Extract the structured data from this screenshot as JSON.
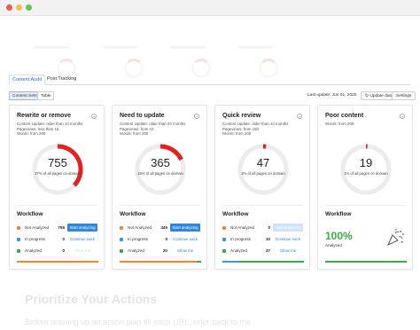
{
  "colors": {
    "accent_blue": "#2f86de",
    "red": "#e32121",
    "orange": "#f1862c",
    "blue": "#3d95e8",
    "green": "#3bab48",
    "ring_track": "#ececec"
  },
  "tabs": [
    {
      "label": "Content Audit",
      "active": true
    },
    {
      "label": "Post Tracking",
      "active": false
    }
  ],
  "toolbar": {
    "view_options": [
      "Content Sets",
      "Table"
    ],
    "active_view": "Content Sets",
    "last_update": "Last update: Jun 01, 2020",
    "update_button": "Update data",
    "settings_button": "Settings"
  },
  "cards": [
    {
      "title": "Rewrite or remove",
      "subtitle": [
        "Content Update: older than 24 months",
        "Pageviews: less than 15",
        "Words: from 200"
      ],
      "count": "755",
      "percent_text": "37% of all pages on domain",
      "percent": 37,
      "ring_color": "#e32121",
      "workflow_title": "Workflow",
      "rows": [
        {
          "status": "Not Analyzed",
          "count": "755",
          "action": "Start analyzing",
          "action_style": "primary",
          "color": "#f1862c"
        },
        {
          "status": "In progress",
          "count": "0",
          "action": "Continue work",
          "action_style": "link",
          "color": "#3d95e8"
        },
        {
          "status": "Analyzed",
          "count": "0",
          "action": "Show me",
          "action_style": "faded",
          "color": "#3bab48"
        }
      ],
      "progress": [
        1.0,
        0,
        0
      ]
    },
    {
      "title": "Need to update",
      "subtitle": [
        "Content Update: older than 24 months",
        "Pageviews: from 15",
        "Words: from 200"
      ],
      "count": "365",
      "percent_text": "18% of all pages on domain",
      "percent": 18,
      "ring_color": "#e32121",
      "workflow_title": "Workflow",
      "rows": [
        {
          "status": "Not Analyzed",
          "count": "345",
          "action": "Start analyzing",
          "action_style": "primary",
          "color": "#f1862c"
        },
        {
          "status": "In progress",
          "count": "0",
          "action": "Continue work",
          "action_style": "link",
          "color": "#3d95e8"
        },
        {
          "status": "Analyzed",
          "count": "20",
          "action": "Show me",
          "action_style": "link",
          "color": "#3bab48"
        }
      ],
      "progress": [
        0.945,
        0,
        0.055
      ]
    },
    {
      "title": "Quick review",
      "subtitle": [
        "Content Update: older than 24 months",
        "Pageviews: from 150",
        "Words: from 200"
      ],
      "count": "47",
      "percent_text": "2% of all pages on domain",
      "percent": 2,
      "ring_color": "#e32121",
      "workflow_title": "Workflow",
      "rows": [
        {
          "status": "Not Analyzed",
          "count": "0",
          "action": "Start analyzing",
          "action_style": "disabled",
          "color": "#f1862c"
        },
        {
          "status": "In progress",
          "count": "10",
          "action": "Continue work",
          "action_style": "link",
          "color": "#3d95e8"
        },
        {
          "status": "Analyzed",
          "count": "37",
          "action": "Show me",
          "action_style": "link",
          "color": "#3bab48"
        }
      ],
      "progress": [
        0,
        0.21,
        0.79
      ]
    },
    {
      "title": "Poor content",
      "subtitle": [
        "Words: from 200"
      ],
      "count": "19",
      "percent_text": "1% of all pages on domain",
      "percent": 1,
      "ring_color": "#e32121",
      "workflow_title": "Workflow",
      "done_percent": "100%",
      "done_label": "Analyzed",
      "progress": [
        0,
        0,
        1.0
      ]
    }
  ],
  "background_text": {
    "heading": "Prioritize Your Actions",
    "paragraph": "Before drawing up an action plan fill each URL, refer back to the"
  }
}
